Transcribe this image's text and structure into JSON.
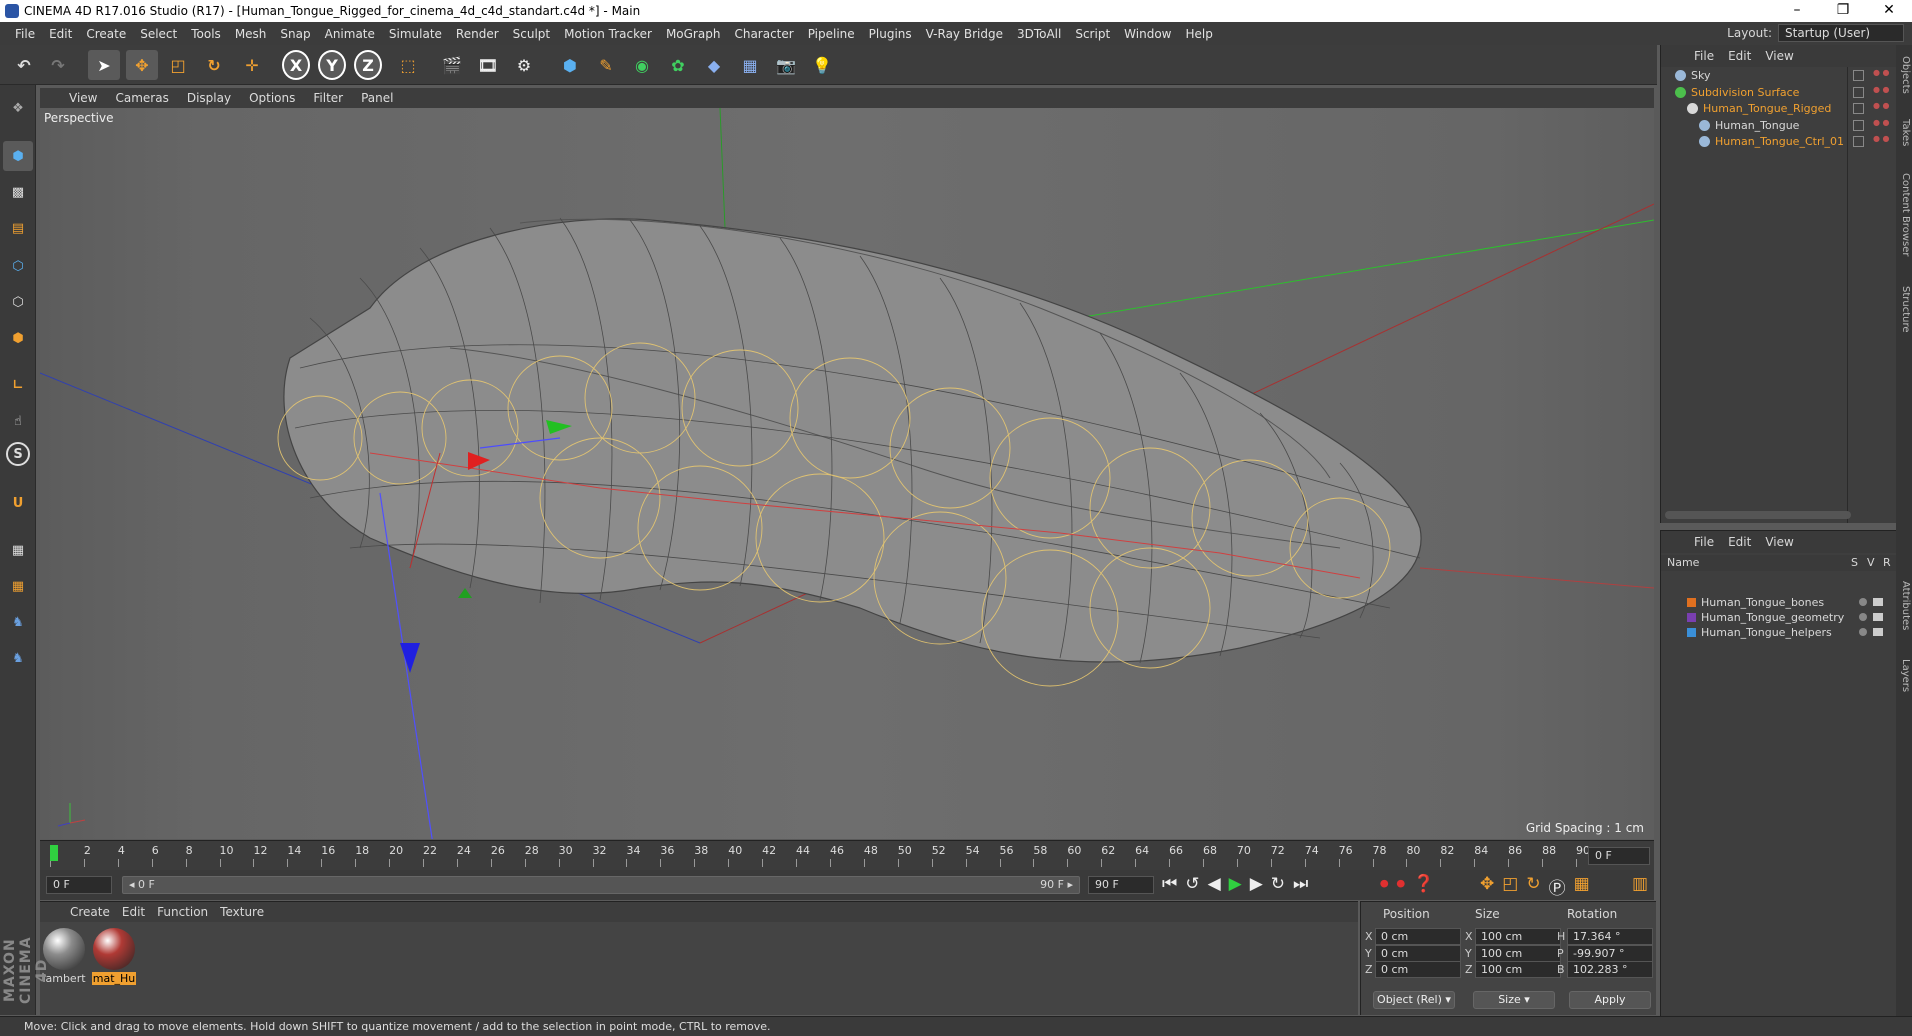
{
  "window": {
    "title": "CINEMA 4D R17.016 Studio (R17) - [Human_Tongue_Rigged_for_cinema_4d_c4d_standart.c4d *] - Main",
    "minimize": "–",
    "maximize": "❐",
    "close": "✕"
  },
  "menu": [
    "File",
    "Edit",
    "Create",
    "Select",
    "Tools",
    "Mesh",
    "Snap",
    "Animate",
    "Simulate",
    "Render",
    "Sculpt",
    "Motion Tracker",
    "MoGraph",
    "Character",
    "Pipeline",
    "Plugins",
    "V-Ray Bridge",
    "3DToAll",
    "Script",
    "Window",
    "Help"
  ],
  "layout": {
    "label": "Layout:",
    "value": "Startup (User)"
  },
  "toolbar": {
    "axis_x": "X",
    "axis_y": "Y",
    "axis_z": "Z"
  },
  "viewport_menu": [
    "View",
    "Cameras",
    "Display",
    "Options",
    "Filter",
    "Panel"
  ],
  "viewport": {
    "label": "Perspective",
    "grid_spacing": "Grid Spacing : 1 cm"
  },
  "timeline": {
    "ticks": [
      "0",
      "2",
      "4",
      "6",
      "8",
      "10",
      "12",
      "14",
      "16",
      "18",
      "20",
      "22",
      "24",
      "26",
      "28",
      "30",
      "32",
      "34",
      "36",
      "38",
      "40",
      "42",
      "44",
      "46",
      "48",
      "50",
      "52",
      "54",
      "56",
      "58",
      "60",
      "62",
      "64",
      "66",
      "68",
      "70",
      "72",
      "74",
      "76",
      "78",
      "80",
      "82",
      "84",
      "86",
      "88",
      "90"
    ],
    "current_frame": "0 F",
    "playhead_fraction": 0
  },
  "transport": {
    "start": "0 F",
    "range_start": "◂ 0 F",
    "range_end": "90 F ▸",
    "end": "90 F"
  },
  "materials": {
    "menu": [
      "Create",
      "Edit",
      "Function",
      "Texture"
    ],
    "items": [
      {
        "name": "lambert",
        "color": "#8c8c8c"
      },
      {
        "name": "mat_Hu",
        "color": "#b03a35"
      }
    ]
  },
  "coords": {
    "headers": {
      "position": "Position",
      "size": "Size",
      "rotation": "Rotation"
    },
    "rows": [
      {
        "axis": "X",
        "pos": "0 cm",
        "size_axis": "X",
        "size": "100 cm",
        "rot_axis": "H",
        "rot": "17.364 °"
      },
      {
        "axis": "Y",
        "pos": "0 cm",
        "size_axis": "Y",
        "size": "100 cm",
        "rot_axis": "P",
        "rot": "-99.907 °"
      },
      {
        "axis": "Z",
        "pos": "0 cm",
        "size_axis": "Z",
        "size": "100 cm",
        "rot_axis": "B",
        "rot": "102.283 °"
      }
    ],
    "mode": "Object (Rel)",
    "size_mode": "Size",
    "apply": "Apply"
  },
  "object_manager": {
    "menu": [
      "File",
      "Edit",
      "View"
    ],
    "objects": [
      {
        "name": "Sky",
        "indent": 0,
        "highlight": false,
        "icon_color": "#9ab8d8"
      },
      {
        "name": "Subdivision Surface",
        "indent": 0,
        "highlight": true,
        "icon_color": "#4cbf4c"
      },
      {
        "name": "Human_Tongue_Rigged",
        "indent": 1,
        "highlight": true,
        "icon_color": "#d8d8d8"
      },
      {
        "name": "Human_Tongue",
        "indent": 2,
        "highlight": false,
        "icon_color": "#9ab8d8"
      },
      {
        "name": "Human_Tongue_Ctrl_01",
        "indent": 2,
        "highlight": true,
        "icon_color": "#9ab8d8"
      }
    ]
  },
  "layer_manager": {
    "menu": [
      "File",
      "Edit",
      "View"
    ],
    "columns": {
      "name": "Name",
      "s": "S",
      "v": "V",
      "r": "R"
    },
    "layers": [
      {
        "name": "Human_Tongue_bones",
        "color": "#e07020"
      },
      {
        "name": "Human_Tongue_geometry",
        "color": "#7a3fb0"
      },
      {
        "name": "Human_Tongue_helpers",
        "color": "#3a8fd8"
      }
    ]
  },
  "side_tabs": [
    "Objects",
    "Takes",
    "Content Browser",
    "Structure",
    "Attributes",
    "Layers"
  ],
  "status": "Move: Click and drag to move elements. Hold down SHIFT to quantize movement / add to the selection in point mode, CTRL to remove.",
  "brand": "MAXON CINEMA 4D"
}
